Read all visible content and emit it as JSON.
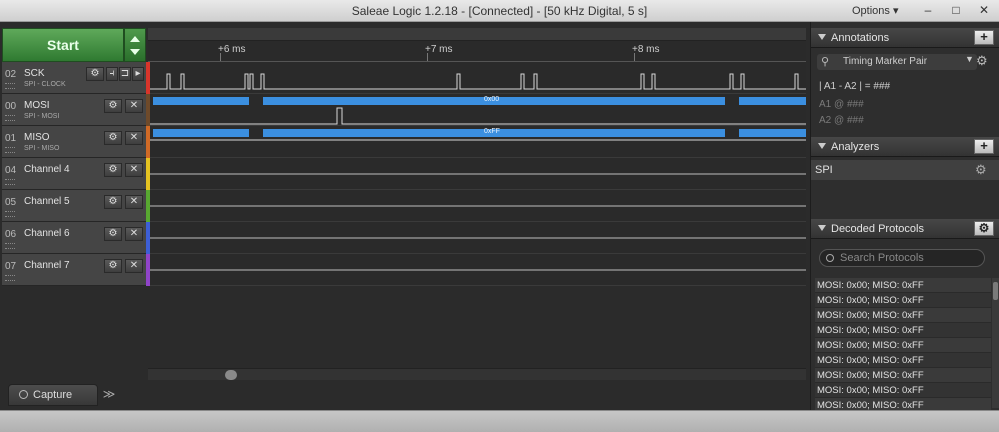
{
  "window": {
    "title": "Saleae Logic 1.2.18 - [Connected] - [50 kHz Digital, 5 s]",
    "options_label": "Options ▾",
    "minimize": "–",
    "maximize": "□",
    "close": "✕"
  },
  "toolbar": {
    "start_label": "Start"
  },
  "ruler": {
    "labels": [
      "+6 ms",
      "+7 ms",
      "+8 ms"
    ]
  },
  "channels": [
    {
      "num": "02",
      "name": "SCK",
      "sub": "SPI - CLOCK",
      "color": "#d9352b"
    },
    {
      "num": "00",
      "name": "MOSI",
      "sub": "SPI - MOSI",
      "color": "#6e4a2a"
    },
    {
      "num": "01",
      "name": "MISO",
      "sub": "SPI - MISO",
      "color": "#d06a26"
    },
    {
      "num": "04",
      "name": "Channel 4",
      "sub": "",
      "color": "#e5c321"
    },
    {
      "num": "05",
      "name": "Channel 5",
      "sub": "",
      "color": "#58a831"
    },
    {
      "num": "06",
      "name": "Channel 6",
      "sub": "",
      "color": "#3d5fd6"
    },
    {
      "num": "07",
      "name": "Channel 7",
      "sub": "",
      "color": "#9044c9"
    }
  ],
  "waves": {
    "mosi_value": "0x00",
    "miso_value": "0xFF",
    "bus_color": "#3b8fe0"
  },
  "bottom": {
    "capture_tab": "Capture",
    "expand_icon": "≫"
  },
  "panels": {
    "annotations": {
      "title": "Annotations",
      "add": "+",
      "marker_pair": "Timing Marker Pair",
      "formula": "| A1 - A2 | = ###",
      "rows": [
        {
          "label": "A1",
          "value": "@ ###"
        },
        {
          "label": "A2",
          "value": "@ ###"
        }
      ]
    },
    "analyzers": {
      "title": "Analyzers",
      "add": "+",
      "items": [
        "SPI"
      ]
    },
    "decoded": {
      "title": "Decoded Protocols",
      "search_placeholder": "Search Protocols",
      "rows": [
        "MOSI: 0x00;  MISO: 0xFF",
        "MOSI: 0x00;  MISO: 0xFF",
        "MOSI: 0x00;  MISO: 0xFF",
        "MOSI: 0x00;  MISO: 0xFF",
        "MOSI: 0x00;  MISO: 0xFF",
        "MOSI: 0x00;  MISO: 0xFF",
        "MOSI: 0x00;  MISO: 0xFF",
        "MOSI: 0x00;  MISO: 0xFF",
        "MOSI: 0x00;  MISO: 0xFF"
      ]
    }
  },
  "icons": {
    "settings": "gear-icon",
    "close": "close-icon",
    "search": "search-icon",
    "pin": "pin-icon",
    "trigger": "trigger-icon"
  }
}
